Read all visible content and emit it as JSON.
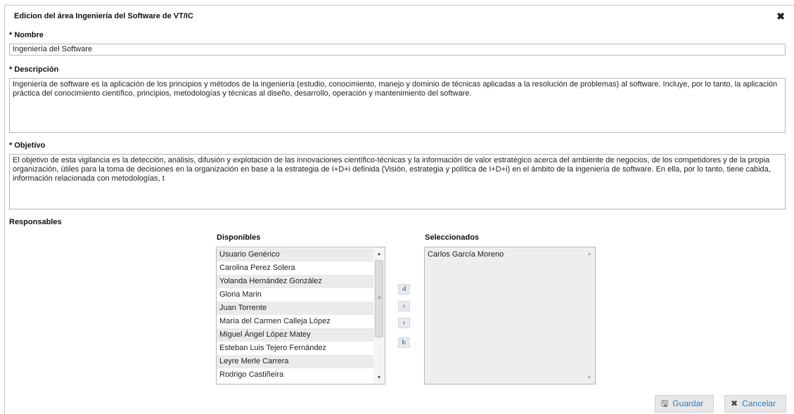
{
  "dialog": {
    "title": "Edicion del área Ingeniería del Software de VT/IC",
    "close_symbol": "✖"
  },
  "nombre": {
    "label": "* Nombre",
    "value": "Ingeniería del Software"
  },
  "descripcion": {
    "label": "* Descripción",
    "value": "Ingeniería de software es la aplicación de los principios y métodos de la ingeniería (estudio, conocimiento, manejo y dominio de técnicas aplicadas a la resolución de problemas) al software. Incluye, por lo tanto, la aplicación práctica del conocimiento científico, principios, metodologías y técnicas al diseño, desarrollo, operación y mantenimiento del software."
  },
  "objetivo": {
    "label": "* Objetivo",
    "value": "El objetivo de esta vigilancia es la detección, análisis, difusión y explotación de las innovaciones científico-técnicas y la información de valor estratégico acerca del ambiente de negocios, de los competidores y de la propia organización, útiles para la toma de decisiones en la organización en base a la estrategia de I+D+i definida (Visión, estrategia y política de I+D+i) en el ámbito de la ingeniería de software. En ella, por lo tanto, tiene cabida, información relacionada con metodologías, t"
  },
  "responsables": {
    "label": "Responsables",
    "disponibles_label": "Disponibles",
    "seleccionados_label": "Seleccionados",
    "disponibles": [
      "Usuario Genérico",
      "Carolina Perez Solera",
      "Yolanda Hernández González",
      "Gloria Marin",
      "Juan Torrente",
      "María del Carmen Calleja López",
      "Miguel Ángel López Matey",
      "Esteban Luis Tejero Fernández",
      "Leyre Merle Carrera",
      "Rodrigo Castiñeira"
    ],
    "seleccionados": [
      "Carlos García Moreno"
    ],
    "move_all_right": "›I",
    "move_right": "›",
    "move_left": "‹",
    "move_all_left": "I‹"
  },
  "buttons": {
    "guardar": "Guardar",
    "cancelar": "Cancelar"
  },
  "icons": {
    "close": "close-icon",
    "save": "floppy-disk-icon",
    "cancel": "x-icon"
  }
}
